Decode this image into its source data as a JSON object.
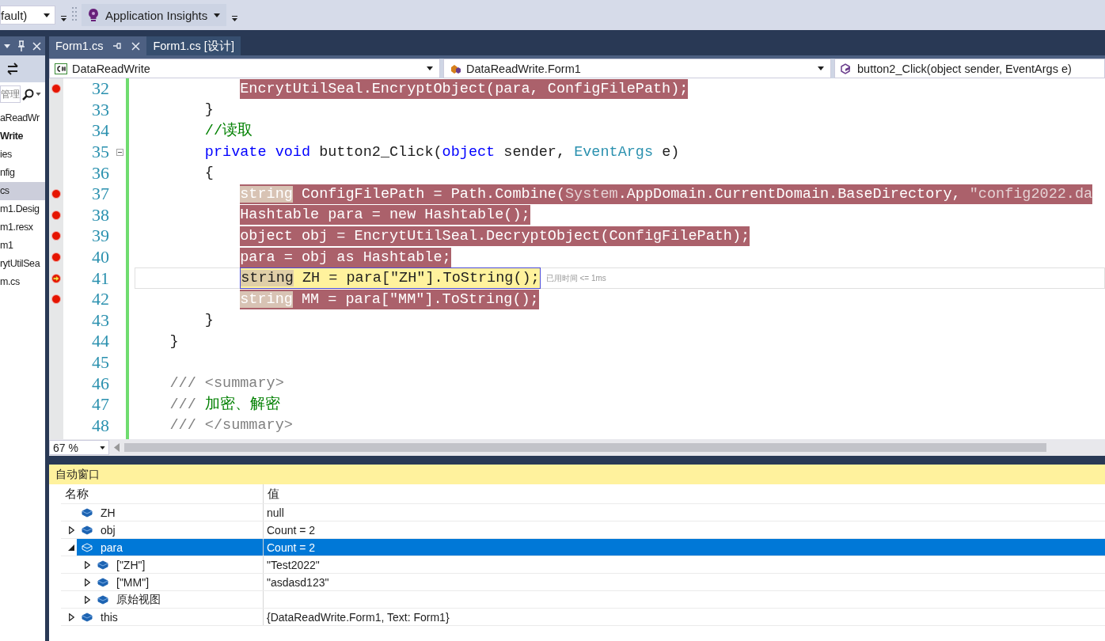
{
  "toolbar": {
    "config_combo": "fault)",
    "insights_button": "Application Insights"
  },
  "solution_explorer": {
    "search": {
      "placeholder": "管理"
    },
    "items": [
      {
        "label": "aReadWr",
        "bold": false,
        "selected": false
      },
      {
        "label": "Write",
        "bold": true,
        "selected": false
      },
      {
        "label": "ies",
        "bold": false,
        "selected": false
      },
      {
        "label": "nfig",
        "bold": false,
        "selected": false
      },
      {
        "label": "cs",
        "bold": false,
        "selected": true
      },
      {
        "label": "m1.Desig",
        "bold": false,
        "selected": false
      },
      {
        "label": "m1.resx",
        "bold": false,
        "selected": false
      },
      {
        "label": "m1",
        "bold": false,
        "selected": false
      },
      {
        "label": "rytUtilSea",
        "bold": false,
        "selected": false
      },
      {
        "label": "m.cs",
        "bold": false,
        "selected": false
      }
    ]
  },
  "tabs": [
    {
      "label": "Form1.cs",
      "selected": true
    },
    {
      "label": "Form1.cs [设计]",
      "selected": false
    }
  ],
  "nav_bar": {
    "project": "DataReadWrite",
    "class": "DataReadWrite.Form1",
    "member": "button2_Click(object sender, EventArgs e)"
  },
  "editor": {
    "lines": [
      {
        "number": "32",
        "breakpoint": true,
        "current": false,
        "tokens": [
          {
            "text": "            EncrytUtilSeal.EncryptObject(para, ConfigFilePath);",
            "kind": "plain"
          }
        ]
      },
      {
        "number": "33",
        "breakpoint": false,
        "current": false,
        "tokens": [
          {
            "text": "        }",
            "kind": "plain"
          }
        ]
      },
      {
        "number": "34",
        "breakpoint": false,
        "current": false,
        "tokens": [
          {
            "text": "        //读取",
            "kind": "comment"
          }
        ]
      },
      {
        "number": "35",
        "breakpoint": false,
        "current": false,
        "foldable": true,
        "tokens": [
          {
            "text": "        private void",
            "kind": "keyword"
          },
          {
            "text": " button2_Click(",
            "kind": "plain"
          },
          {
            "text": "object",
            "kind": "keyword"
          },
          {
            "text": " sender, ",
            "kind": "plain"
          },
          {
            "text": "EventArgs",
            "kind": "type"
          },
          {
            "text": " e)",
            "kind": "plain"
          }
        ]
      },
      {
        "number": "36",
        "breakpoint": false,
        "current": false,
        "tokens": [
          {
            "text": "        {",
            "kind": "plain"
          }
        ]
      },
      {
        "number": "37",
        "breakpoint": true,
        "current": false,
        "tokens": [
          {
            "text": "            string",
            "kind": "match"
          },
          {
            "text": " ConfigFilePath = Path.Combine(",
            "kind": "plain"
          },
          {
            "text": "System",
            "kind": "type"
          },
          {
            "text": ".AppDomain.CurrentDomain.BaseDirectory, ",
            "kind": "plain"
          },
          {
            "text": "\"config2022.da",
            "kind": "string"
          }
        ]
      },
      {
        "number": "38",
        "breakpoint": true,
        "current": false,
        "tokens": [
          {
            "text": "            Hashtable para = new Hashtable();",
            "kind": "plain"
          }
        ]
      },
      {
        "number": "39",
        "breakpoint": true,
        "current": false,
        "tokens": [
          {
            "text": "            object obj = EncrytUtilSeal.DecryptObject(ConfigFilePath);",
            "kind": "plain"
          }
        ]
      },
      {
        "number": "40",
        "breakpoint": true,
        "current": false,
        "tokens": [
          {
            "text": "            para = obj as Hashtable;",
            "kind": "plain"
          }
        ]
      },
      {
        "number": "41",
        "breakpoint": true,
        "current": true,
        "perf_tip": "已用时间 <= 1ms",
        "tokens": [
          {
            "text": "            string",
            "kind": "match"
          },
          {
            "text": " ZH = para[\"ZH\"].ToString();",
            "kind": "plain"
          }
        ]
      },
      {
        "number": "42",
        "breakpoint": true,
        "current": false,
        "tokens": [
          {
            "text": "            string",
            "kind": "match"
          },
          {
            "text": " MM = para[\"MM\"].ToString();",
            "kind": "plain"
          }
        ]
      },
      {
        "number": "43",
        "breakpoint": false,
        "current": false,
        "tokens": [
          {
            "text": "        }",
            "kind": "plain"
          }
        ]
      },
      {
        "number": "44",
        "breakpoint": false,
        "current": false,
        "tokens": [
          {
            "text": "    }",
            "kind": "plain"
          }
        ]
      },
      {
        "number": "45",
        "breakpoint": false,
        "current": false
      },
      {
        "number": "46",
        "breakpoint": false,
        "current": false,
        "tokens": [
          {
            "text": "    /// <summary>",
            "kind": "doc"
          }
        ]
      },
      {
        "number": "47",
        "breakpoint": false,
        "current": false,
        "tokens": [
          {
            "text": "    /// ",
            "kind": "doc"
          },
          {
            "text": "加密、解密",
            "kind": "comment"
          }
        ]
      },
      {
        "number": "48",
        "breakpoint": false,
        "current": false,
        "tokens": [
          {
            "text": "    /// </summary>",
            "kind": "doc"
          }
        ]
      }
    ],
    "zoom": "67 %"
  },
  "autos": {
    "title": "自动窗口",
    "columns": [
      "名称",
      "值"
    ],
    "rows": [
      {
        "name": "ZH",
        "value": "null",
        "selected": false
      },
      {
        "name": "obj",
        "value": "Count = 2",
        "expanded": false,
        "selected": false
      },
      {
        "name": "para",
        "value": "Count = 2",
        "expanded": true,
        "selected": true,
        "children": [
          {
            "name": "[\"ZH\"]",
            "value": "\"Test2022\"",
            "expanded": false,
            "selected": false
          },
          {
            "name": "[\"MM\"]",
            "value": "\"asdasd123\"",
            "expanded": false,
            "selected": false
          },
          {
            "name": "原始视图",
            "expanded": false,
            "selected": false
          }
        ]
      },
      {
        "name": "this",
        "value": "{DataReadWrite.Form1, Text: Form1}",
        "expanded": false,
        "selected": false
      }
    ]
  }
}
